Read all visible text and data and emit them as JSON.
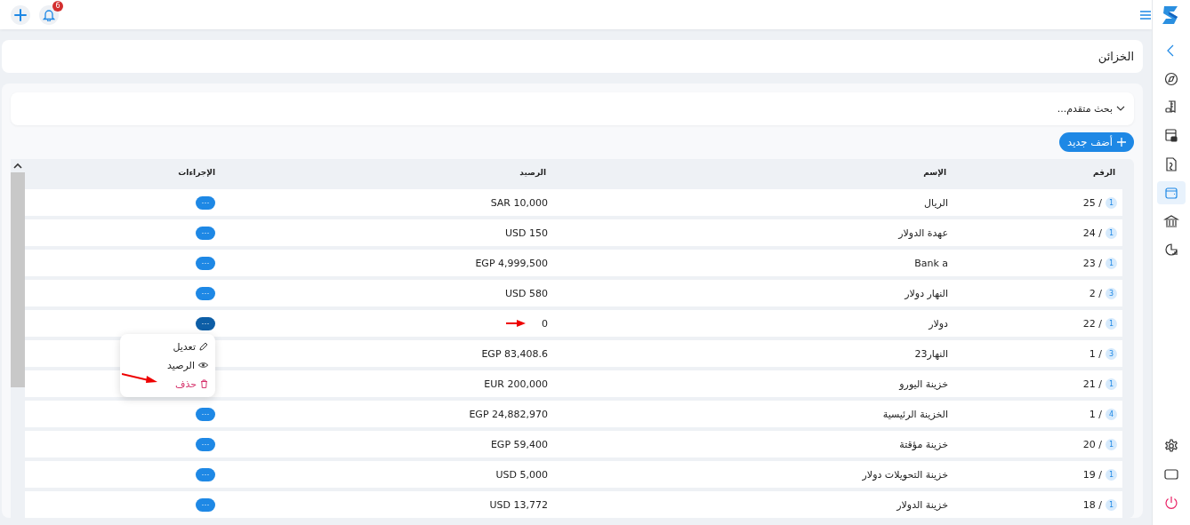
{
  "topbar": {
    "notifications": "6"
  },
  "sidebar": {
    "items": [
      {
        "kind": "collapse",
        "selected": false
      },
      {
        "kind": "compass",
        "selected": false
      },
      {
        "kind": "receipt",
        "selected": false
      },
      {
        "kind": "register",
        "selected": false
      },
      {
        "kind": "document",
        "selected": false
      },
      {
        "kind": "wallet",
        "selected": true
      },
      {
        "kind": "bank",
        "selected": false
      },
      {
        "kind": "chart",
        "selected": false
      }
    ],
    "bottom": [
      {
        "kind": "settings"
      },
      {
        "kind": "screen"
      },
      {
        "kind": "power"
      }
    ]
  },
  "page_title": "الخزائن",
  "advanced_search": {
    "label": "بحث متقدم...",
    "expanded": false
  },
  "add_button": "أضف جديد",
  "table": {
    "columns": [
      "الرقم",
      "الإسم",
      "الرصيد",
      "الإجراءات"
    ],
    "rows": [
      {
        "badge": "1",
        "number": "25 /",
        "name": "الريال",
        "balance": "SAR 10,000",
        "actions": "···",
        "menu_open": false,
        "marked": false
      },
      {
        "badge": "1",
        "number": "24 /",
        "name": "عهدة الدولار",
        "balance": "USD 150",
        "actions": "···",
        "menu_open": false,
        "marked": false
      },
      {
        "badge": "1",
        "number": "23 /",
        "name": "Bank a",
        "balance": "EGP 4,999,500",
        "actions": "···",
        "menu_open": false,
        "marked": false
      },
      {
        "badge": "3",
        "number": "2 /",
        "name": "النهار دولار",
        "balance": "USD 580",
        "actions": "···",
        "menu_open": false,
        "marked": false
      },
      {
        "badge": "1",
        "number": "22 /",
        "name": "دولار",
        "balance": "0",
        "actions": "···",
        "menu_open": true,
        "marked": true
      },
      {
        "badge": "3",
        "number": "1 /",
        "name": "النهار23",
        "balance": "EGP 83,408.6",
        "menu_open": false,
        "marked": false
      },
      {
        "badge": "1",
        "number": "21 /",
        "name": "خزينة اليورو",
        "balance": "EUR 200,000",
        "menu_open": false,
        "marked": false
      },
      {
        "badge": "4",
        "number": "1 /",
        "name": "الخزينة الرئيسية",
        "balance": "EGP 24,882,970",
        "actions": "···",
        "menu_open": false,
        "marked": false
      },
      {
        "badge": "1",
        "number": "20 /",
        "name": "خزينة مؤقتة",
        "balance": "EGP 59,400",
        "actions": "···",
        "menu_open": false,
        "marked": false
      },
      {
        "badge": "1",
        "number": "19 /",
        "name": "خزينة التحويلات دولار",
        "balance": "USD 5,000",
        "actions": "···",
        "menu_open": false,
        "marked": false
      },
      {
        "badge": "1",
        "number": "18 /",
        "name": "خزينة الدولار",
        "balance": "USD 13,772",
        "actions": "···",
        "menu_open": false,
        "marked": false
      }
    ]
  },
  "action_menu": [
    {
      "kind": "edit",
      "label": "تعديل",
      "marked": false
    },
    {
      "kind": "view",
      "label": "الرصيد",
      "marked": false
    },
    {
      "kind": "delete",
      "label": "حذف",
      "marked": true
    }
  ]
}
